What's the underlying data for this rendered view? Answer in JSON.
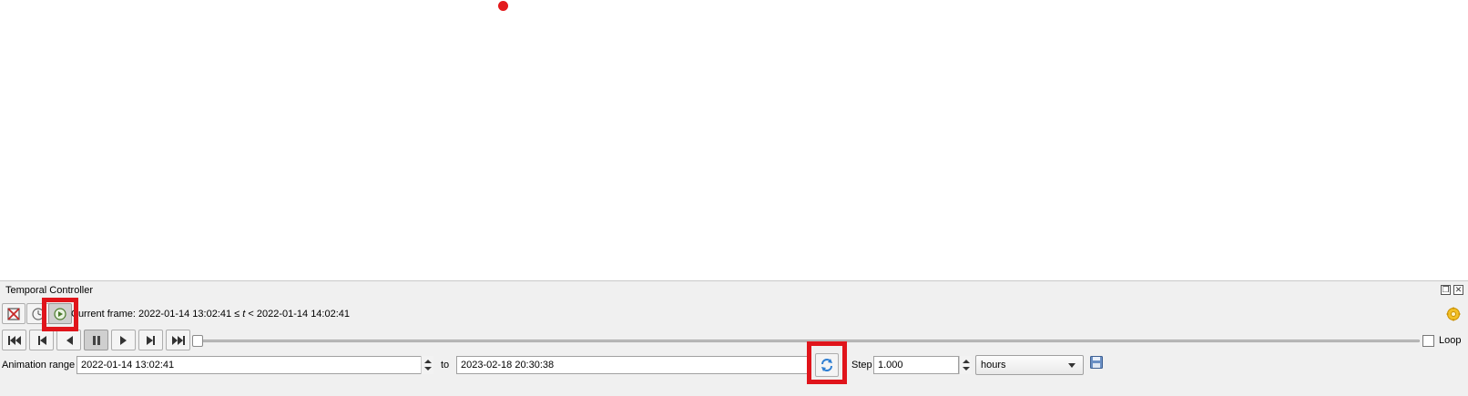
{
  "panel": {
    "title": "Temporal Controller",
    "float_glyph": "❐",
    "close_glyph": "✕"
  },
  "toolbar": {
    "mode_buttons": [
      {
        "name": "disable-temporal-icon",
        "checked": false
      },
      {
        "name": "fixed-range-icon",
        "checked": false
      },
      {
        "name": "animated-navigation-icon",
        "checked": true
      }
    ],
    "current_frame_label": "Current frame: 2022-01-14 13:02:41 ≤ ",
    "current_frame_var": "t",
    "current_frame_end": " < 2022-01-14 14:02:41"
  },
  "playback": {
    "buttons": [
      "rewind-to-start-icon",
      "previous-frame-icon",
      "play-backward-icon",
      "pause-icon",
      "play-forward-icon",
      "next-frame-icon",
      "skip-to-end-icon"
    ],
    "active": "pause-icon",
    "slider_fraction": 0,
    "loop_label": "Loop",
    "loop_checked": false
  },
  "range": {
    "label": "Animation range",
    "start_value": "2022-01-14 13:02:41",
    "to_label": "to",
    "end_value": "2023-02-18 20:30:38",
    "step_label": "Step",
    "step_value": "1.000",
    "unit_value": "hours"
  },
  "colors": {
    "highlight": "#e0141b",
    "point": "#e31a1c",
    "accent_blue": "#2f7fd3"
  }
}
